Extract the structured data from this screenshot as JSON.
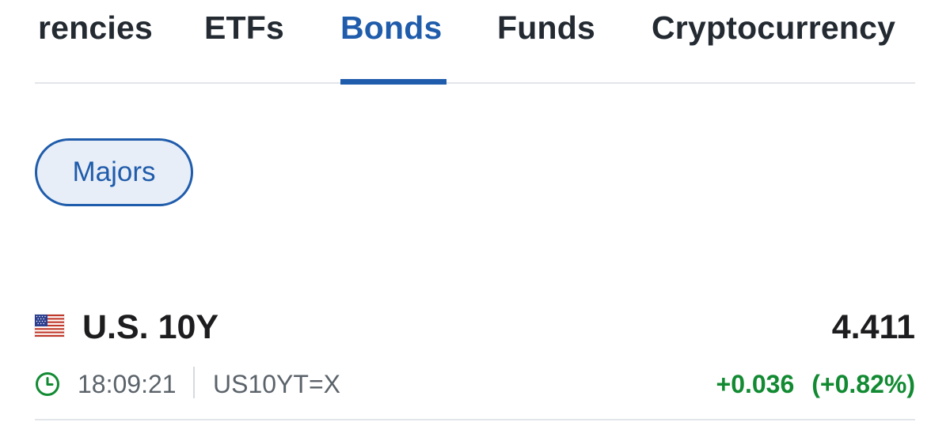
{
  "tabs": [
    {
      "label": "rencies",
      "active": false
    },
    {
      "label": "ETFs",
      "active": false
    },
    {
      "label": "Bonds",
      "active": true
    },
    {
      "label": "Funds",
      "active": false
    },
    {
      "label": "Cryptocurrency",
      "active": false
    }
  ],
  "filter": {
    "label": "Majors",
    "selected": true
  },
  "quote": {
    "flag": "us-flag-icon",
    "name": "U.S. 10Y",
    "price": "4.411",
    "time": "18:09:21",
    "symbol": "US10YT=X",
    "change": "+0.036",
    "change_pct": "(+0.82%)",
    "clock_icon": "clock-icon"
  },
  "colors": {
    "accent": "#1f5cab",
    "positive": "#128a32",
    "chip_bg": "#e8eef7",
    "muted_text": "#5b636a"
  }
}
